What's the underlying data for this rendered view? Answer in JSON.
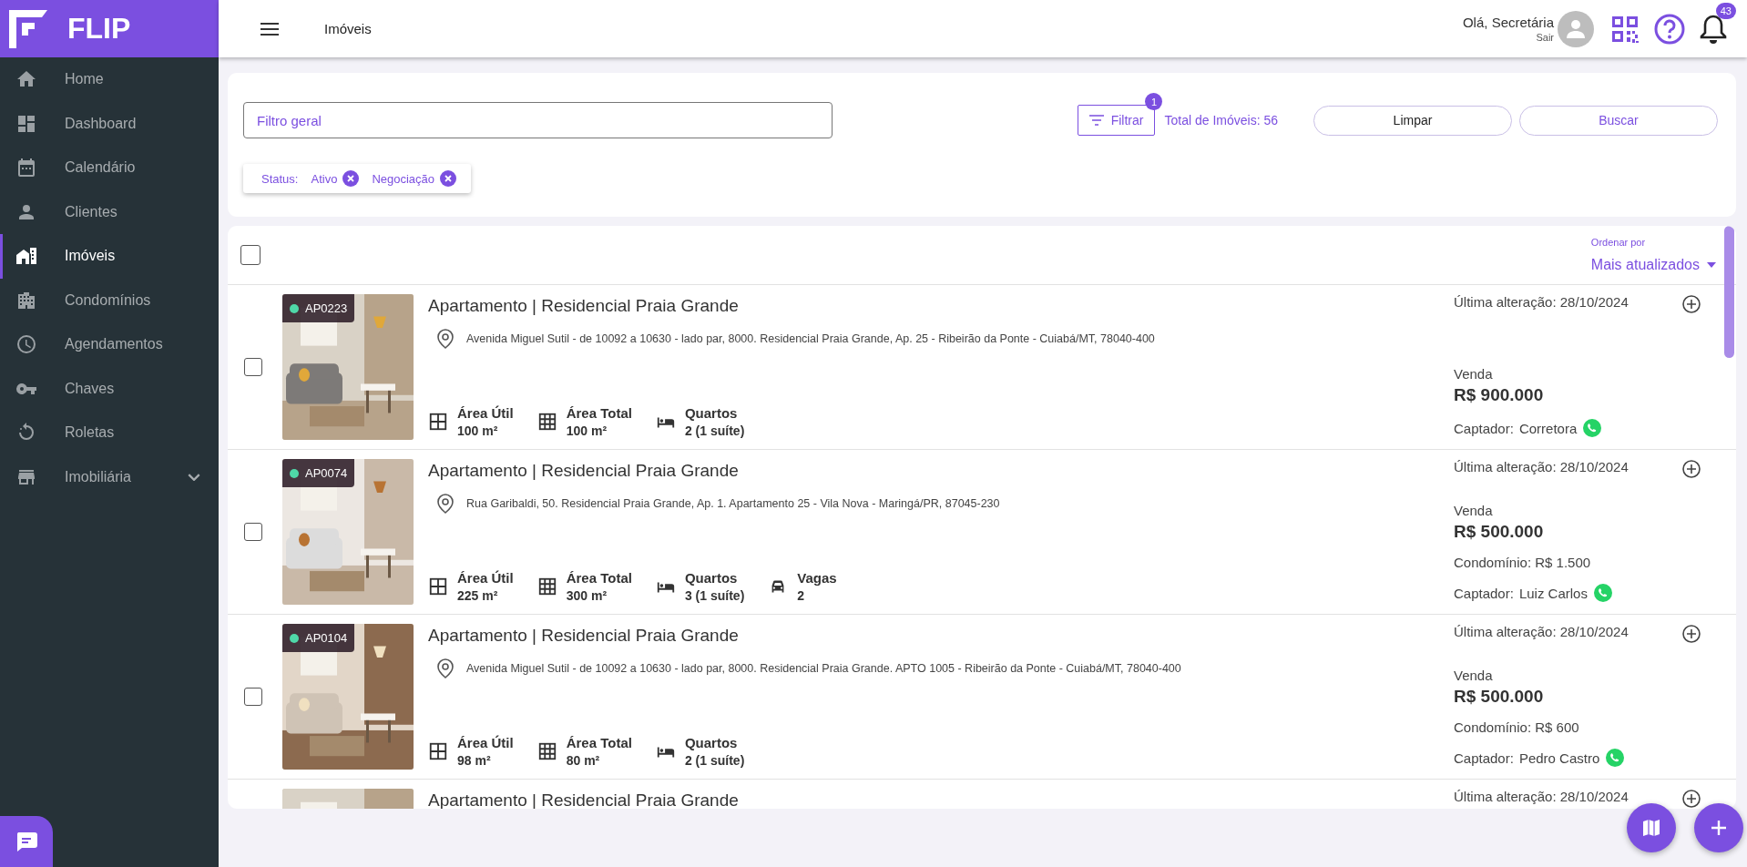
{
  "sidebar": {
    "logo": "FLIP",
    "items": [
      {
        "label": "Home",
        "selected": false
      },
      {
        "label": "Dashboard",
        "selected": false
      },
      {
        "label": "Calendário",
        "selected": false
      },
      {
        "label": "Clientes",
        "selected": false
      },
      {
        "label": "Imóveis",
        "selected": true
      },
      {
        "label": "Condomínios",
        "selected": false
      },
      {
        "label": "Agendamentos",
        "selected": false
      },
      {
        "label": "Chaves",
        "selected": false
      },
      {
        "label": "Roletas",
        "selected": false
      },
      {
        "label": "Imobiliária",
        "selected": false,
        "expandable": true
      }
    ]
  },
  "header": {
    "title": "Imóveis",
    "greeting": "Olá, Secretária",
    "logout": "Sair",
    "notification_count": "43"
  },
  "filters": {
    "search_placeholder": "Filtro geral",
    "filter_button": "Filtrar",
    "filter_count": "1",
    "total": "Total de Imóveis: 56",
    "clear_button": "Limpar",
    "search_button": "Buscar",
    "chips_label": "Status:",
    "chips": [
      "Ativo",
      "Negociação"
    ]
  },
  "list": {
    "select_all_checked": false,
    "sort_label": "Ordenar por",
    "sort_value": "Mais atualizados",
    "properties": [
      {
        "checked": false,
        "code": "AP0223",
        "title": "Apartamento | Residencial Praia Grande",
        "address": "Avenida Miguel Sutil - de 10092 a 10630 - lado par, 8000. Residencial Praia Grande, Ap. 25 - Ribeirão da Ponte - Cuiabá/MT, 78040-400",
        "features": [
          {
            "kind": "usable_area",
            "label": "Área Útil",
            "value": "100 m²"
          },
          {
            "kind": "total_area",
            "label": "Área Total",
            "value": "100 m²"
          },
          {
            "kind": "bedrooms",
            "label": "Quartos",
            "value": "2 (1 suíte)"
          }
        ],
        "updated": "Última alteração: 28/10/2024",
        "deal": "Venda",
        "price": "R$ 900.000",
        "agent_label": "Captador:",
        "agent": "Corretora"
      },
      {
        "checked": false,
        "code": "AP0074",
        "title": "Apartamento | Residencial Praia Grande",
        "address": "Rua Garibaldi, 50. Residencial Praia Grande, Ap. 1. Apartamento 25 - Vila Nova - Maringá/PR, 87045-230",
        "features": [
          {
            "kind": "usable_area",
            "label": "Área Útil",
            "value": "225 m²"
          },
          {
            "kind": "total_area",
            "label": "Área Total",
            "value": "300 m²"
          },
          {
            "kind": "bedrooms",
            "label": "Quartos",
            "value": "3 (1 suíte)"
          },
          {
            "kind": "parking",
            "label": "Vagas",
            "value": "2"
          }
        ],
        "updated": "Última alteração: 28/10/2024",
        "deal": "Venda",
        "price": "R$ 500.000",
        "condo": "Condomínio: R$ 1.500",
        "agent_label": "Captador:",
        "agent": "Luiz Carlos"
      },
      {
        "checked": false,
        "code": "AP0104",
        "title": "Apartamento | Residencial Praia Grande",
        "address": "Avenida Miguel Sutil - de 10092 a 10630 - lado par, 8000. Residencial Praia Grande. APTO 1005 - Ribeirão da Ponte - Cuiabá/MT, 78040-400",
        "features": [
          {
            "kind": "usable_area",
            "label": "Área Útil",
            "value": "98 m²"
          },
          {
            "kind": "total_area",
            "label": "Área Total",
            "value": "80 m²"
          },
          {
            "kind": "bedrooms",
            "label": "Quartos",
            "value": "2 (1 suíte)"
          }
        ],
        "updated": "Última alteração: 28/10/2024",
        "deal": "Venda",
        "price": "R$ 500.000",
        "condo": "Condomínio: R$ 600",
        "agent_label": "Captador:",
        "agent": "Pedro Castro"
      },
      {
        "title": "Apartamento | Residencial Praia Grande",
        "updated": "Última alteração: 28/10/2024"
      }
    ]
  }
}
